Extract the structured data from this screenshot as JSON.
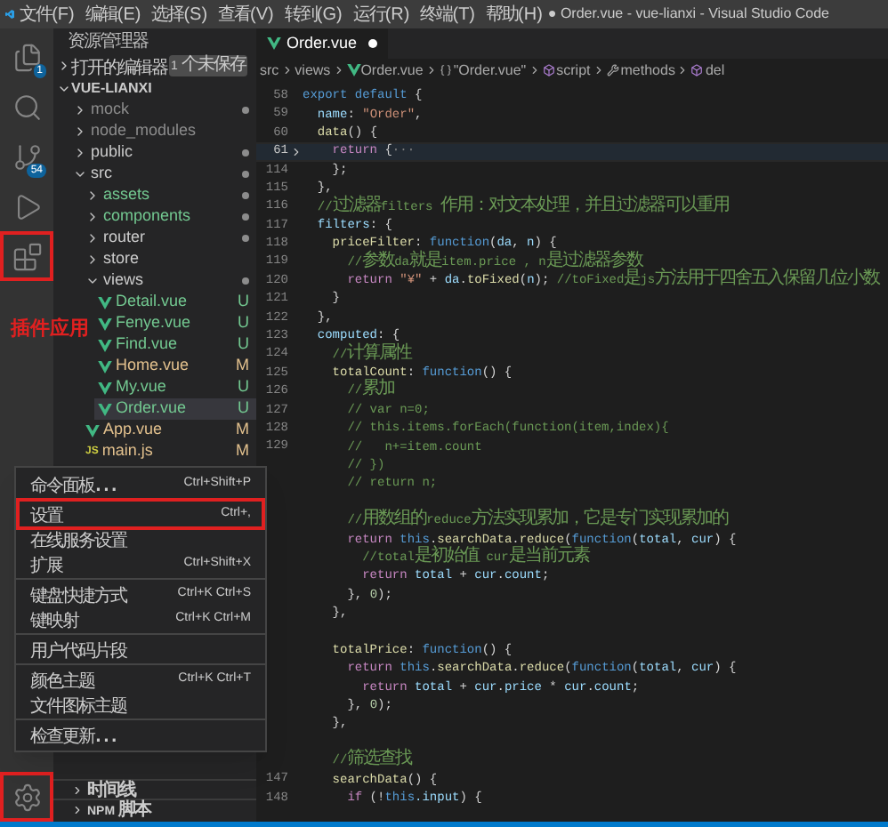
{
  "title_bar": {
    "menus": [
      "文件(F)",
      "编辑(E)",
      "选择(S)",
      "查看(V)",
      "转到(G)",
      "运行(R)",
      "终端(T)",
      "帮助(H)"
    ],
    "title": "● Order.vue - vue-lianxi - Visual Studio Code"
  },
  "activity_bar": {
    "top": [
      {
        "kind": "files",
        "badge": "1",
        "highlighted": false
      },
      {
        "kind": "search",
        "highlighted": false
      },
      {
        "kind": "source-control",
        "badge": "54",
        "highlighted": false
      },
      {
        "kind": "run",
        "highlighted": false
      },
      {
        "kind": "extensions",
        "highlighted": true
      }
    ],
    "bottom": [
      {
        "kind": "settings",
        "highlighted": true
      }
    ]
  },
  "annotation": "插件应用",
  "sidebar": {
    "title": "资源管理器",
    "open_editors": {
      "label": "打开的编辑器",
      "badge": "1 个未保存"
    },
    "project": "VUE-LIANXI",
    "items": [
      {
        "label": "mock",
        "kind": "folder",
        "expanded": false,
        "color": "#8c8c8c",
        "dot": true,
        "selected": false
      },
      {
        "label": "node_modules",
        "kind": "folder",
        "expanded": false,
        "color": "#8c8c8c",
        "dot": false,
        "selected": false
      },
      {
        "label": "public",
        "kind": "folder",
        "expanded": false,
        "color": "#cccccc",
        "dot": true,
        "selected": false
      },
      {
        "label": "src",
        "kind": "folder",
        "expanded": true,
        "color": "#cccccc",
        "dot": true,
        "selected": false,
        "children": [
          {
            "label": "assets",
            "kind": "folder",
            "expanded": false,
            "color": "#73c991",
            "dot": true,
            "selected": false
          },
          {
            "label": "components",
            "kind": "folder",
            "expanded": false,
            "color": "#73c991",
            "dot": true,
            "selected": false
          },
          {
            "label": "router",
            "kind": "folder",
            "expanded": false,
            "color": "#cccccc",
            "dot": true,
            "selected": false
          },
          {
            "label": "store",
            "kind": "folder",
            "expanded": false,
            "color": "#cccccc",
            "dot": false,
            "selected": false
          },
          {
            "label": "views",
            "kind": "folder",
            "expanded": true,
            "color": "#cccccc",
            "dot": true,
            "selected": false,
            "children": [
              {
                "label": "Detail.vue",
                "kind": "vue",
                "color": "#73c991",
                "status": "U",
                "selected": false
              },
              {
                "label": "Fenye.vue",
                "kind": "vue",
                "color": "#73c991",
                "status": "U",
                "selected": false
              },
              {
                "label": "Find.vue",
                "kind": "vue",
                "color": "#73c991",
                "status": "U",
                "selected": false
              },
              {
                "label": "Home.vue",
                "kind": "vue",
                "color": "#e2c08d",
                "status": "M",
                "selected": false
              },
              {
                "label": "My.vue",
                "kind": "vue",
                "color": "#73c991",
                "status": "U",
                "selected": false
              },
              {
                "label": "Order.vue",
                "kind": "vue",
                "color": "#73c991",
                "status": "U",
                "selected": true
              }
            ]
          },
          {
            "label": "App.vue",
            "kind": "vue",
            "color": "#e2c08d",
            "status": "M",
            "selected": false
          },
          {
            "label": "main.js",
            "kind": "js",
            "icon_text": "JS",
            "color": "#e2c08d",
            "status": "M",
            "selected": false
          }
        ]
      }
    ],
    "panels": [
      "时间线",
      "NPM 脚本"
    ]
  },
  "tab": {
    "label": "Order.vue",
    "dirty": true
  },
  "breadcrumb": [
    {
      "kind": "text",
      "label": "src"
    },
    {
      "kind": "text",
      "label": "views"
    },
    {
      "kind": "vue",
      "label": "Order.vue"
    },
    {
      "kind": "braces",
      "label": "\"Order.vue\""
    },
    {
      "kind": "cube",
      "label": "script"
    },
    {
      "kind": "wrench",
      "label": "methods"
    },
    {
      "kind": "cube",
      "label": "del"
    }
  ],
  "code": [
    {
      "n": "58",
      "current": false,
      "folded": false,
      "tokens": [
        {
          "kind": "kw",
          "t": "export default"
        },
        {
          "kind": "p",
          "t": " {"
        }
      ]
    },
    {
      "n": "59",
      "current": false,
      "folded": false,
      "tokens": [
        {
          "kind": "prop",
          "t": "  name"
        },
        {
          "kind": "p",
          "t": ": "
        },
        {
          "kind": "str",
          "t": "\"Order\""
        },
        {
          "kind": "p",
          "t": ","
        }
      ]
    },
    {
      "n": "60",
      "current": false,
      "folded": false,
      "tokens": [
        {
          "kind": "fn",
          "t": "  data"
        },
        {
          "kind": "p",
          "t": "() {"
        }
      ]
    },
    {
      "n": "61",
      "current": true,
      "folded": true,
      "tokens": [
        {
          "kind": "ctl",
          "t": "    return"
        },
        {
          "kind": "p",
          "t": " {"
        },
        {
          "kind": "dim",
          "t": "···"
        }
      ]
    },
    {
      "n": "114",
      "current": false,
      "folded": false,
      "tokens": [
        {
          "kind": "p",
          "t": "    };"
        }
      ]
    },
    {
      "n": "115",
      "current": false,
      "folded": false,
      "tokens": [
        {
          "kind": "p",
          "t": "  },"
        }
      ]
    },
    {
      "n": "116",
      "current": false,
      "folded": false,
      "tokens": [
        {
          "kind": "com",
          "t": "  //过滤器filters 作用：对文本处理，并且过滤器可以重用"
        }
      ]
    },
    {
      "n": "117",
      "current": false,
      "folded": false,
      "tokens": [
        {
          "kind": "prop",
          "t": "  filters"
        },
        {
          "kind": "p",
          "t": ": {"
        }
      ]
    },
    {
      "n": "118",
      "current": false,
      "folded": false,
      "tokens": [
        {
          "kind": "fn",
          "t": "    priceFilter"
        },
        {
          "kind": "p",
          "t": ": "
        },
        {
          "kind": "kw",
          "t": "function"
        },
        {
          "kind": "p",
          "t": "("
        },
        {
          "kind": "prop",
          "t": "da"
        },
        {
          "kind": "p",
          "t": ", "
        },
        {
          "kind": "prop",
          "t": "n"
        },
        {
          "kind": "p",
          "t": ") {"
        }
      ]
    },
    {
      "n": "119",
      "current": false,
      "folded": false,
      "tokens": [
        {
          "kind": "com",
          "t": "      //参数da就是item.price , n是过滤器参数"
        }
      ]
    },
    {
      "n": "120",
      "current": false,
      "folded": false,
      "tokens": [
        {
          "kind": "ctl",
          "t": "      return"
        },
        {
          "kind": "str",
          "t": " \"¥\""
        },
        {
          "kind": "p",
          "t": " + "
        },
        {
          "kind": "prop",
          "t": "da"
        },
        {
          "kind": "p",
          "t": "."
        },
        {
          "kind": "fn",
          "t": "toFixed"
        },
        {
          "kind": "p",
          "t": "("
        },
        {
          "kind": "prop",
          "t": "n"
        },
        {
          "kind": "p",
          "t": "); "
        },
        {
          "kind": "com",
          "t": "//toFixed是js方法用于四舍五入保留几位小数"
        }
      ]
    },
    {
      "n": "121",
      "current": false,
      "folded": false,
      "tokens": [
        {
          "kind": "p",
          "t": "    }"
        }
      ]
    },
    {
      "n": "122",
      "current": false,
      "folded": false,
      "tokens": [
        {
          "kind": "p",
          "t": "  },"
        }
      ]
    },
    {
      "n": "123",
      "current": false,
      "folded": false,
      "tokens": [
        {
          "kind": "prop",
          "t": "  computed"
        },
        {
          "kind": "p",
          "t": ": {"
        }
      ]
    },
    {
      "n": "124",
      "current": false,
      "folded": false,
      "tokens": [
        {
          "kind": "com",
          "t": "    //计算属性"
        }
      ]
    },
    {
      "n": "125",
      "current": false,
      "folded": false,
      "tokens": [
        {
          "kind": "fn",
          "t": "    totalCount"
        },
        {
          "kind": "p",
          "t": ": "
        },
        {
          "kind": "kw",
          "t": "function"
        },
        {
          "kind": "p",
          "t": "() {"
        }
      ]
    },
    {
      "n": "126",
      "current": false,
      "folded": false,
      "tokens": [
        {
          "kind": "com",
          "t": "      //累加"
        }
      ]
    },
    {
      "n": "127",
      "current": false,
      "folded": false,
      "tokens": [
        {
          "kind": "com",
          "t": "      // var n=0;"
        }
      ]
    },
    {
      "n": "128",
      "current": false,
      "folded": false,
      "tokens": [
        {
          "kind": "com",
          "t": "      // this.items.forEach(function(item,index){"
        }
      ]
    },
    {
      "n": "129",
      "current": false,
      "folded": false,
      "tokens": [
        {
          "kind": "com",
          "t": "      //   n+=item.count"
        }
      ]
    },
    {
      "current": false,
      "folded": false,
      "tokens": [
        {
          "kind": "com",
          "t": "      // })"
        }
      ]
    },
    {
      "current": false,
      "folded": false,
      "tokens": [
        {
          "kind": "com",
          "t": "      // return n;"
        }
      ]
    },
    {
      "current": false,
      "folded": false
    },
    {
      "current": false,
      "folded": false,
      "tokens": [
        {
          "kind": "com",
          "t": "      //用数组的reduce方法实现累加，它是专门实现累加的"
        }
      ]
    },
    {
      "current": false,
      "folded": false,
      "tokens": [
        {
          "kind": "ctl",
          "t": "      return"
        },
        {
          "kind": "kw",
          "t": " this"
        },
        {
          "kind": "p",
          "t": "."
        },
        {
          "kind": "fn",
          "t": "searchData"
        },
        {
          "kind": "p",
          "t": "."
        },
        {
          "kind": "fn",
          "t": "reduce"
        },
        {
          "kind": "p",
          "t": "("
        },
        {
          "kind": "kw",
          "t": "function"
        },
        {
          "kind": "p",
          "t": "("
        },
        {
          "kind": "prop",
          "t": "total"
        },
        {
          "kind": "p",
          "t": ", "
        },
        {
          "kind": "prop",
          "t": "cur"
        },
        {
          "kind": "p",
          "t": ") {"
        }
      ]
    },
    {
      "current": false,
      "folded": false,
      "tokens": [
        {
          "kind": "com",
          "t": "        //total是初始值 cur是当前元素"
        }
      ]
    },
    {
      "current": false,
      "folded": false,
      "tokens": [
        {
          "kind": "ctl",
          "t": "        return"
        },
        {
          "kind": "prop",
          "t": " total"
        },
        {
          "kind": "p",
          "t": " + "
        },
        {
          "kind": "prop",
          "t": "cur"
        },
        {
          "kind": "p",
          "t": "."
        },
        {
          "kind": "prop",
          "t": "count"
        },
        {
          "kind": "p",
          "t": ";"
        }
      ]
    },
    {
      "current": false,
      "folded": false,
      "tokens": [
        {
          "kind": "p",
          "t": "      }, "
        },
        {
          "kind": "num",
          "t": "0"
        },
        {
          "kind": "p",
          "t": ");"
        }
      ]
    },
    {
      "current": false,
      "folded": false,
      "tokens": [
        {
          "kind": "p",
          "t": "    },"
        }
      ]
    },
    {
      "current": false,
      "folded": false
    },
    {
      "current": false,
      "folded": false,
      "tokens": [
        {
          "kind": "fn",
          "t": "    totalPrice"
        },
        {
          "kind": "p",
          "t": ": "
        },
        {
          "kind": "kw",
          "t": "function"
        },
        {
          "kind": "p",
          "t": "() {"
        }
      ]
    },
    {
      "current": false,
      "folded": false,
      "tokens": [
        {
          "kind": "ctl",
          "t": "      return"
        },
        {
          "kind": "kw",
          "t": " this"
        },
        {
          "kind": "p",
          "t": "."
        },
        {
          "kind": "fn",
          "t": "searchData"
        },
        {
          "kind": "p",
          "t": "."
        },
        {
          "kind": "fn",
          "t": "reduce"
        },
        {
          "kind": "p",
          "t": "("
        },
        {
          "kind": "kw",
          "t": "function"
        },
        {
          "kind": "p",
          "t": "("
        },
        {
          "kind": "prop",
          "t": "total"
        },
        {
          "kind": "p",
          "t": ", "
        },
        {
          "kind": "prop",
          "t": "cur"
        },
        {
          "kind": "p",
          "t": ") {"
        }
      ]
    },
    {
      "current": false,
      "folded": false,
      "tokens": [
        {
          "kind": "ctl",
          "t": "        return"
        },
        {
          "kind": "prop",
          "t": " total"
        },
        {
          "kind": "p",
          "t": " + "
        },
        {
          "kind": "prop",
          "t": "cur"
        },
        {
          "kind": "p",
          "t": "."
        },
        {
          "kind": "prop",
          "t": "price"
        },
        {
          "kind": "p",
          "t": " * "
        },
        {
          "kind": "prop",
          "t": "cur"
        },
        {
          "kind": "p",
          "t": "."
        },
        {
          "kind": "prop",
          "t": "count"
        },
        {
          "kind": "p",
          "t": ";"
        }
      ]
    },
    {
      "current": false,
      "folded": false,
      "tokens": [
        {
          "kind": "p",
          "t": "      }, "
        },
        {
          "kind": "num",
          "t": "0"
        },
        {
          "kind": "p",
          "t": ");"
        }
      ]
    },
    {
      "current": false,
      "folded": false,
      "tokens": [
        {
          "kind": "p",
          "t": "    },"
        }
      ]
    },
    {
      "current": false,
      "folded": false
    },
    {
      "current": false,
      "folded": false,
      "tokens": [
        {
          "kind": "com",
          "t": "    //筛选查找"
        }
      ]
    },
    {
      "n": "147",
      "current": false,
      "folded": false,
      "tokens": [
        {
          "kind": "fn",
          "t": "    searchData"
        },
        {
          "kind": "p",
          "t": "() {"
        }
      ]
    },
    {
      "n": "148",
      "current": false,
      "folded": false,
      "tokens": [
        {
          "kind": "ctl",
          "t": "      if"
        },
        {
          "kind": "p",
          "t": " (!"
        },
        {
          "kind": "kw",
          "t": "this"
        },
        {
          "kind": "prop",
          "t": ".input"
        },
        {
          "kind": "p",
          "t": ") {"
        }
      ]
    }
  ],
  "menu": {
    "groups": [
      {
        "items": [
          {
            "label": "命令面板...",
            "shortcut": "Ctrl+Shift+P",
            "highlighted": false
          }
        ]
      },
      {
        "items": [
          {
            "label": "设置",
            "shortcut": "Ctrl+,",
            "highlighted": true
          },
          {
            "label": "在线服务设置",
            "highlighted": false
          },
          {
            "label": "扩展",
            "shortcut": "Ctrl+Shift+X",
            "highlighted": false
          }
        ]
      },
      {
        "items": [
          {
            "label": "键盘快捷方式",
            "shortcut": "Ctrl+K Ctrl+S",
            "highlighted": false
          },
          {
            "label": "键映射",
            "shortcut": "Ctrl+K Ctrl+M",
            "highlighted": false
          }
        ]
      },
      {
        "items": [
          {
            "label": "用户代码片段",
            "highlighted": false
          }
        ]
      },
      {
        "items": [
          {
            "label": "颜色主题",
            "shortcut": "Ctrl+K Ctrl+T",
            "highlighted": false
          },
          {
            "label": "文件图标主题",
            "highlighted": false
          }
        ]
      },
      {
        "items": [
          {
            "label": "检查更新...",
            "highlighted": false
          }
        ]
      }
    ]
  }
}
